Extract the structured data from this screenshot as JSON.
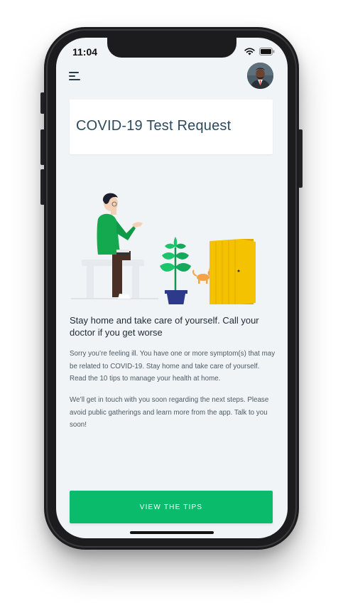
{
  "status_bar": {
    "time": "11:04"
  },
  "header": {
    "menu_icon": "menu-icon",
    "avatar": "user-avatar"
  },
  "title_card": {
    "title": "COVID-19 Test Request"
  },
  "content": {
    "heading": "Stay home and take care of yourself. Call your doctor if you get worse",
    "paragraph_1": "Sorry you’re feeling ill. You have one or more symptom(s) that may be related to COVID-19. Stay home and take care of yourself. Read the 10 tips to manage your health at home.",
    "paragraph_2": "We’ll get in touch with you soon regarding the next steps. Please avoid public gatherings and learn more from the app. Talk to you soon!"
  },
  "cta": {
    "label": "VIEW THE TIPS"
  },
  "colors": {
    "accent": "#0abb6b",
    "title_text": "#2c4a5e",
    "background": "#f0f4f7",
    "door": "#f5c200"
  }
}
